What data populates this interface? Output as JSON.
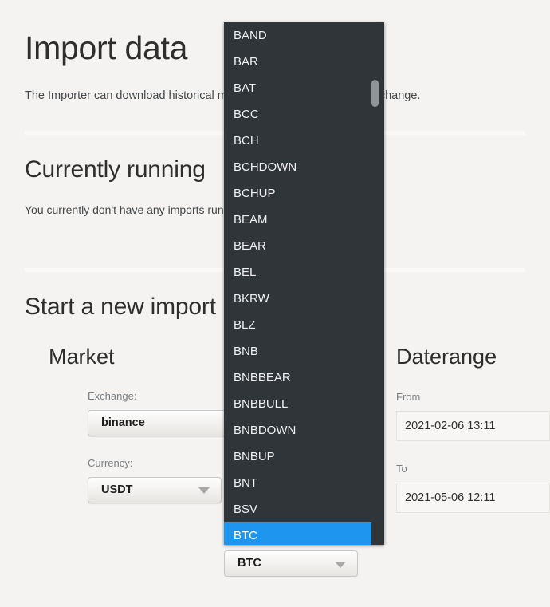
{
  "page": {
    "title": "Import data",
    "intro": "The Importer can download historical market data directly from the exchange.",
    "sections": [
      {
        "title": "Currently running",
        "text": "You currently don't have any imports running."
      },
      {
        "title": "Start a new import"
      }
    ]
  },
  "market": {
    "title": "Market",
    "exchange_label": "Exchange:",
    "exchange_value": "binance",
    "currency_label": "Currency:",
    "currency_value": "USDT",
    "asset_value": "BTC"
  },
  "daterange": {
    "title": "Daterange",
    "from_label": "From",
    "from_value": "2021-02-06 13:11",
    "to_label": "To",
    "to_value": "2021-05-06 12:11"
  },
  "dropdown": {
    "selected": "BTC",
    "items": [
      "BAND",
      "BAR",
      "BAT",
      "BCC",
      "BCH",
      "BCHDOWN",
      "BCHUP",
      "BEAM",
      "BEAR",
      "BEL",
      "BKRW",
      "BLZ",
      "BNB",
      "BNBBEAR",
      "BNBBULL",
      "BNBDOWN",
      "BNBUP",
      "BNT",
      "BSV",
      "BTC"
    ]
  },
  "colors": {
    "page_background": "#f4f3f1",
    "dropdown_background": "#30353a",
    "highlight": "#1e96ef",
    "scrollbar_thumb": "#8f9499",
    "heading": "#2e2e2e",
    "label": "#7b7f84"
  }
}
